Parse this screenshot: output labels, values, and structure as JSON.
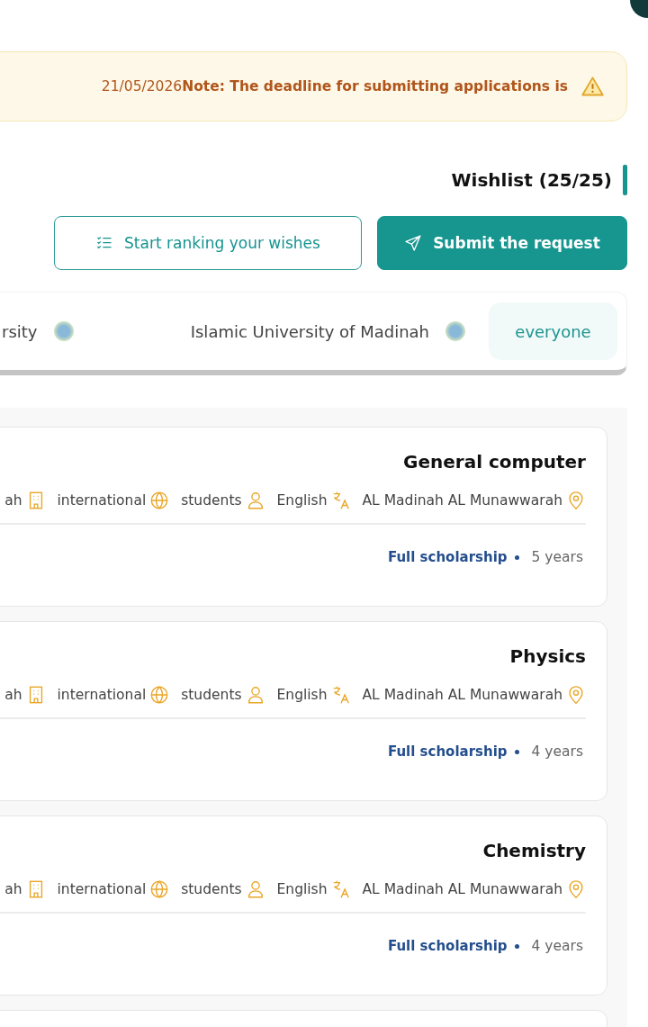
{
  "notice": {
    "text": "21/05/2026**Note: The deadline for submitting applications is**"
  },
  "wishlist": {
    "title": "Wishlist (25/25)"
  },
  "buttons": [
    {
      "kind": "outline",
      "label": "Start ranking your wishes"
    },
    {
      "kind": "filled",
      "label": "Submit the request"
    }
  ],
  "tabs": [
    {
      "label": "rsity",
      "selected": false
    },
    {
      "label": "Islamic University of Madinah",
      "selected": false
    },
    {
      "label": "everyone",
      "selected": true
    }
  ],
  "programs": [
    {
      "title": "General computer",
      "meta": [
        {
          "kind": "building",
          "text": "ah"
        },
        {
          "kind": "globe",
          "text": "international"
        },
        {
          "kind": "person",
          "text": "students"
        },
        {
          "kind": "language",
          "text": "English"
        },
        {
          "kind": "location",
          "text": "AL Madinah AL Munawwarah"
        }
      ],
      "funding": "Full scholarship",
      "duration": "5 years"
    },
    {
      "title": "Physics",
      "meta": [
        {
          "kind": "building",
          "text": "ah"
        },
        {
          "kind": "globe",
          "text": "international"
        },
        {
          "kind": "person",
          "text": "students"
        },
        {
          "kind": "language",
          "text": "English"
        },
        {
          "kind": "location",
          "text": "AL Madinah AL Munawwarah"
        }
      ],
      "funding": "Full scholarship",
      "duration": "4 years"
    },
    {
      "title": "Chemistry",
      "meta": [
        {
          "kind": "building",
          "text": "ah"
        },
        {
          "kind": "globe",
          "text": "international"
        },
        {
          "kind": "person",
          "text": "students"
        },
        {
          "kind": "language",
          "text": "English"
        },
        {
          "kind": "location",
          "text": "AL Madinah AL Munawwarah"
        }
      ],
      "funding": "Full scholarship",
      "duration": "4 years"
    }
  ]
}
